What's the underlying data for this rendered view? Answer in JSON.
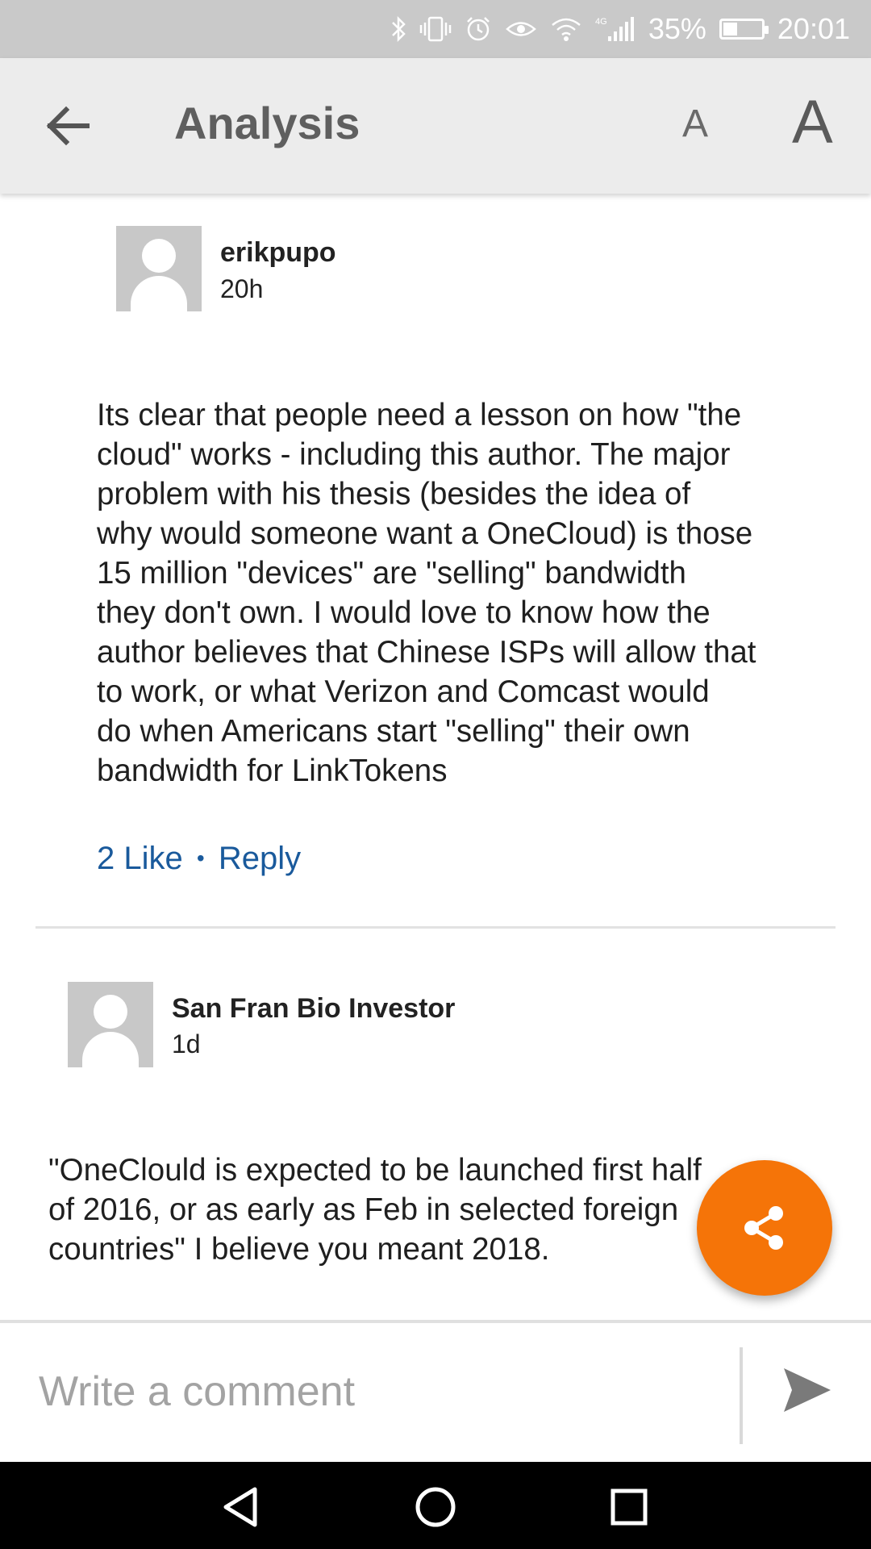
{
  "status_bar": {
    "battery_percent": "35%",
    "time": "20:01",
    "network_label": "4G",
    "icons": [
      "bluetooth-icon",
      "vibrate-icon",
      "alarm-icon",
      "eye-icon",
      "wifi-icon",
      "signal-icon",
      "battery-icon"
    ]
  },
  "header": {
    "title": "Analysis",
    "font_small_label": "A",
    "font_large_label": "A"
  },
  "comments": [
    {
      "author": "erikpupo",
      "time": "20h",
      "text_lines": [
        "Its clear that people need a lesson on how \"the",
        "cloud\" works - including this author. The major",
        "problem with his thesis (besides the idea of",
        "why would someone want a OneCloud) is those",
        "15 million \"devices\" are \"selling\" bandwidth",
        "they don't own. I would love to know how the",
        "author believes that Chinese ISPs will allow that",
        "to work, or what Verizon and Comcast would",
        "do when Americans start \"selling\" their own",
        "bandwidth for LinkTokens"
      ],
      "like_label": "2 Like",
      "separator": "•",
      "reply_label": "Reply"
    },
    {
      "author": "San Fran Bio Investor",
      "time": "1d",
      "text_lines": [
        "\"OneClould is expected to be launched first half",
        "of 2016, or as early as Feb in selected foreign",
        "countries\" I believe you meant 2018."
      ]
    }
  ],
  "comment_bar": {
    "placeholder": "Write a comment"
  },
  "colors": {
    "accent": "#f57408",
    "link": "#1a5a9c",
    "status_bar": "#c9c9c9",
    "app_bar": "#ececec"
  }
}
